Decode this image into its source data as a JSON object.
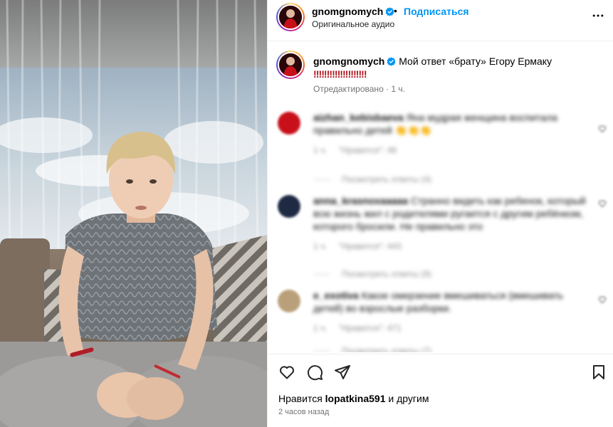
{
  "post": {
    "username": "gnomgnomych",
    "separator": "•",
    "follow_label": "Подписаться",
    "audio_label": "Оригинальное аудио",
    "caption_text": "Мой ответ «брату» Егору Ермаку",
    "caption_exclaims": "‼‼‼‼‼‼‼‼‼‼",
    "caption_meta": "Отредактировано · 1 ч."
  },
  "comments": [
    {
      "username": "aizhan_kebisbaeva",
      "text": "Яна мудрая женщина воспитала правильно детей 👏👏👏",
      "time": "1 ч.",
      "likes": "\"Нравится\": 48",
      "replies": "Посмотреть ответы (4)",
      "avatar_color": "#c8101a"
    },
    {
      "username": "anna_krasnoxaaaaa",
      "text": "Странно видеть как ребенок, который всю жизнь жил с родителями ругается с другим ребёнком, которого бросили. Не правильно это",
      "time": "1 ч.",
      "likes": "\"Нравится\": 443",
      "replies": "Посмотреть ответы (9)",
      "avatar_color": "#1e2a44"
    },
    {
      "username": "e_exotiva",
      "text": "Какое омерзение вмешиваться (вмешивать детей) во взрослые разборки.",
      "time": "1 ч.",
      "likes": "\"Нравится\": 471",
      "replies": "Посмотреть ответы (7)",
      "avatar_color": "#b9a07a"
    }
  ],
  "footer": {
    "likes_prefix": "Нравится",
    "likes_user": "lopatkina591",
    "likes_suffix": "и другим",
    "timestamp": "2 часов назад"
  },
  "colors": {
    "accent": "#0095f6",
    "verified": "#0095f6",
    "exclaim": "#b0131d"
  },
  "icons": {
    "like": "heart-icon",
    "comment": "comment-icon",
    "share": "send-icon",
    "save": "bookmark-icon",
    "more": "more-horizontal-icon",
    "verified": "verified-badge-icon"
  }
}
